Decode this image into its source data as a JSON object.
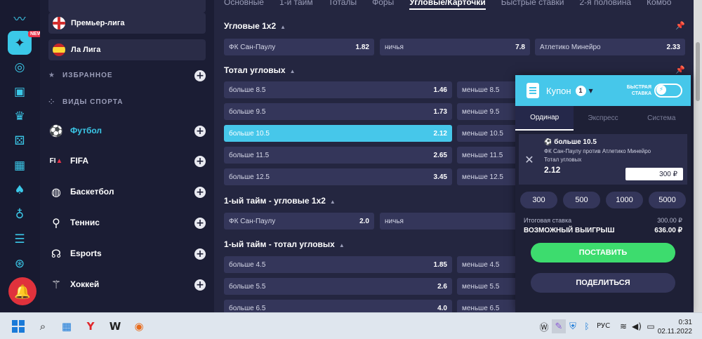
{
  "rail": {
    "new_badge": "NEW",
    "icons": [
      "trend-icon",
      "lottery-icon",
      "basketball-icon",
      "briefcase-icon",
      "crown-icon",
      "dice-icon",
      "scoreboard-icon",
      "cards-icon",
      "apple-icon",
      "ladder-icon",
      "roulette-icon",
      "bell-icon"
    ]
  },
  "nav": {
    "leagues": [
      {
        "label": "Премьер-лига",
        "flag": "england"
      },
      {
        "label": "Ла Лига",
        "flag": "spain"
      }
    ],
    "favorites": "ИЗБРАННОЕ",
    "sports_header": "ВИДЫ СПОРТА",
    "sports": [
      {
        "label": "Футбол",
        "icon": "soccer-ball-icon"
      },
      {
        "label": "FIFA",
        "icon": "fifa-icon"
      },
      {
        "label": "Баскетбол",
        "icon": "basketball-icon"
      },
      {
        "label": "Теннис",
        "icon": "tennis-icon"
      },
      {
        "label": "Esports",
        "icon": "headset-icon"
      },
      {
        "label": "Хоккей",
        "icon": "hockey-icon"
      }
    ]
  },
  "main": {
    "tabs": [
      "Основные",
      "1-й тайм",
      "Тоталы",
      "Форы",
      "Угловые/Карточки",
      "Быстрые ставки",
      "2-я половина",
      "Комбо"
    ],
    "active_tab": "Угловые/Карточки",
    "sections": [
      {
        "title": "Угловые 1х2",
        "rows": [
          [
            {
              "l": "ФК Сан-Паулу",
              "v": "1.82"
            },
            {
              "l": "ничья",
              "v": "7.8"
            },
            {
              "l": "Атлетико Минейро",
              "v": "2.33"
            }
          ]
        ]
      },
      {
        "title": "Тотал угловых",
        "rows": [
          [
            {
              "l": "больше 8.5",
              "v": "1.46"
            },
            {
              "l": "меньше 8.5",
              "v": ""
            }
          ],
          [
            {
              "l": "больше 9.5",
              "v": "1.73"
            },
            {
              "l": "меньше 9.5",
              "v": ""
            }
          ],
          [
            {
              "l": "больше 10.5",
              "v": "2.12",
              "selected": true
            },
            {
              "l": "меньше 10.5",
              "v": ""
            }
          ],
          [
            {
              "l": "больше 11.5",
              "v": "2.65"
            },
            {
              "l": "меньше 11.5",
              "v": ""
            }
          ],
          [
            {
              "l": "больше 12.5",
              "v": "3.45"
            },
            {
              "l": "меньше 12.5",
              "v": ""
            }
          ]
        ]
      },
      {
        "title": "1-ый тайм - угловые 1х2",
        "rows": [
          [
            {
              "l": "ФК Сан-Паулу",
              "v": "2.0"
            },
            {
              "l": "ничья",
              "v": ""
            }
          ]
        ]
      },
      {
        "title": "1-ый тайм - тотал угловых",
        "rows": [
          [
            {
              "l": "больше 4.5",
              "v": "1.85"
            },
            {
              "l": "меньше 4.5",
              "v": ""
            }
          ],
          [
            {
              "l": "больше 5.5",
              "v": "2.6"
            },
            {
              "l": "меньше 5.5",
              "v": ""
            }
          ],
          [
            {
              "l": "больше 6.5",
              "v": "4.0"
            },
            {
              "l": "меньше 6.5",
              "v": ""
            }
          ]
        ]
      }
    ]
  },
  "coupon": {
    "title": "Купон",
    "count": "1",
    "fast_bet": "БЫСТРАЯ СТАВКА",
    "tabs": [
      "Ординар",
      "Экспресс",
      "Система"
    ],
    "active_tab": "Ординар",
    "bet": {
      "selection": "больше 10.5",
      "match": "ФК Сан-Паулу против Атлетико Минейро",
      "market": "Тотал угловых",
      "odd": "2.12",
      "stake": "300 ₽"
    },
    "quick_stakes": [
      "300",
      "500",
      "1000",
      "5000"
    ],
    "total_label": "Итоговая ставка",
    "total_value": "300.00 ₽",
    "win_label": "ВОЗМОЖНЫЙ ВЫИГРЫШ",
    "win_value": "636.00 ₽",
    "place_button": "ПОСТАВИТЬ",
    "share_button": "ПОДЕЛИТЬСЯ"
  },
  "taskbar": {
    "lang": "РУС",
    "time": "0:31",
    "date": "02.11.2022"
  }
}
